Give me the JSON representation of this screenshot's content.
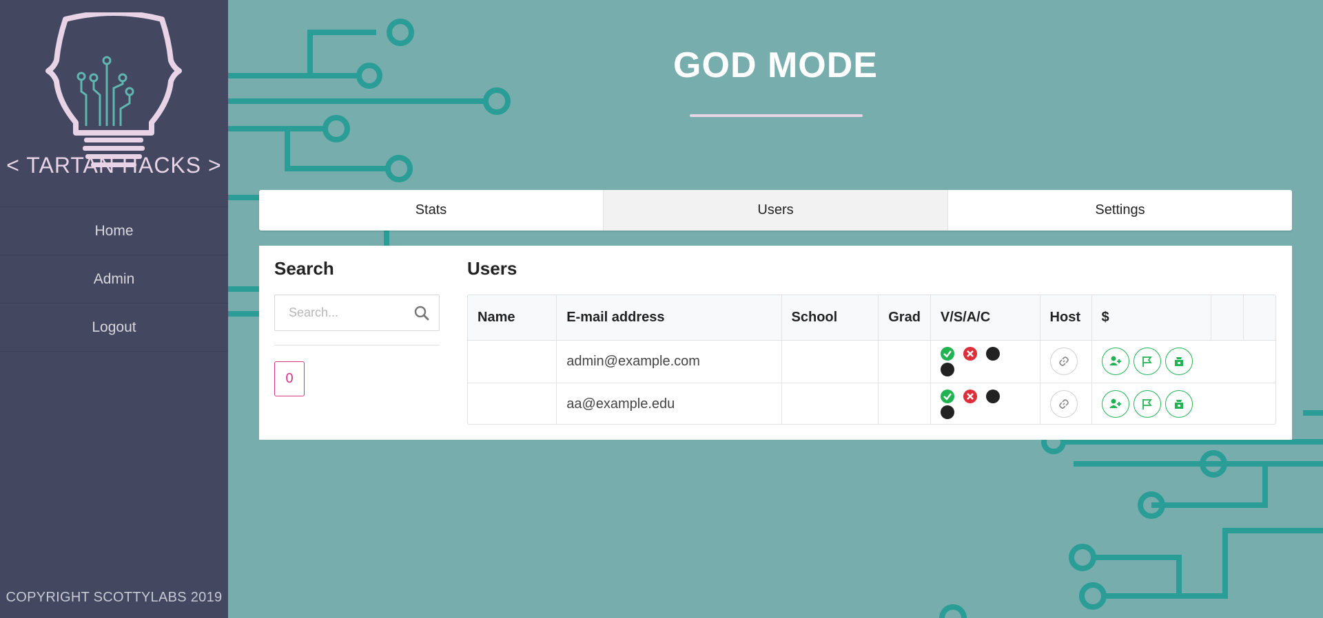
{
  "brand": {
    "name": "< TARTAN HACKS >",
    "colors": {
      "sidebar": "#434760",
      "teal": "#77adad",
      "circuit": "#2a9d96",
      "pink": "#e8d4e6",
      "accent_green": "#21b352",
      "accent_red": "#dc2f3a",
      "badge": "#d63384"
    }
  },
  "sidebar": {
    "items": [
      {
        "label": "Home"
      },
      {
        "label": "Admin"
      },
      {
        "label": "Logout"
      }
    ],
    "copyright": "COPYRIGHT SCOTTYLABS 2019"
  },
  "header": {
    "title": "GOD MODE"
  },
  "tabs": [
    {
      "label": "Stats",
      "active": false
    },
    {
      "label": "Users",
      "active": true
    },
    {
      "label": "Settings",
      "active": false
    }
  ],
  "search": {
    "heading": "Search",
    "placeholder": "Search...",
    "icon": "search-icon",
    "count": "0"
  },
  "users": {
    "heading": "Users",
    "columns": [
      "Name",
      "E-mail address",
      "School",
      "Grad",
      "V/S/A/C",
      "Host",
      "$",
      "",
      ""
    ],
    "rows": [
      {
        "name": "",
        "email": "admin@example.com",
        "school": "",
        "grad": "",
        "status": [
          "check",
          "x",
          "dot",
          "dot"
        ]
      },
      {
        "name": "",
        "email": "aa@example.edu",
        "school": "",
        "grad": "",
        "status": [
          "check",
          "x",
          "dot",
          "dot"
        ]
      }
    ],
    "row_actions": [
      "link-icon",
      "add-user-icon",
      "flag-icon",
      "sponsor-icon"
    ]
  }
}
